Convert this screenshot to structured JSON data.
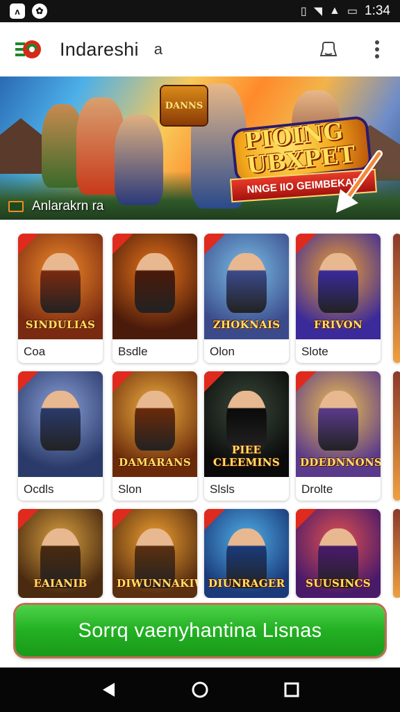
{
  "status_bar": {
    "time": "1:34",
    "left_icons": [
      "notification-app-icon",
      "notification-circle-icon"
    ],
    "right_icons": [
      "vibrate-icon",
      "wifi-icon",
      "signal-icon",
      "battery-icon"
    ]
  },
  "app_bar": {
    "title": "Indareshi",
    "subtitle": "a",
    "actions": [
      "profile-icon",
      "more-vert-icon"
    ]
  },
  "banner": {
    "headline_line1": "PIOING",
    "headline_line2": "UBXPET",
    "ribbon": "NNGE IIO GEIMBEKAD",
    "left_badge": "DANNS",
    "caption": "Anlarakrn ra"
  },
  "games": [
    {
      "label": "Coa",
      "art_title": "SINDULIAS",
      "colors": [
        "#7a2a10",
        "#f08a2a"
      ]
    },
    {
      "label": "Bsdle",
      "art_title": "",
      "colors": [
        "#4a1a0a",
        "#e8741a"
      ]
    },
    {
      "label": "Olon",
      "art_title": "ZHOKNAIS",
      "colors": [
        "#3b4a8a",
        "#7ac0e8"
      ]
    },
    {
      "label": "Slote",
      "art_title": "FRIVON",
      "colors": [
        "#3a2a9a",
        "#f0a030"
      ]
    },
    {
      "label": "Ocdls",
      "art_title": "",
      "colors": [
        "#2a3a6a",
        "#8aa0d8"
      ]
    },
    {
      "label": "Slon",
      "art_title": "DAMARANS",
      "colors": [
        "#6a2a0a",
        "#f0b040"
      ]
    },
    {
      "label": "Slsls",
      "art_title": "PIEE CLEEMINS",
      "colors": [
        "#0a0a0a",
        "#3a4a3a"
      ]
    },
    {
      "label": "Drolte",
      "art_title": "DDEDNNONS",
      "colors": [
        "#5a3a8a",
        "#f0c050"
      ]
    },
    {
      "label": "",
      "art_title": "EAIANIB",
      "colors": [
        "#4a2a10",
        "#d8a040"
      ]
    },
    {
      "label": "",
      "art_title": "DIWUNNAKIWY",
      "colors": [
        "#5a3010",
        "#f0a030"
      ]
    },
    {
      "label": "",
      "art_title": "DIUNRAGER",
      "colors": [
        "#1a3a7a",
        "#50b0e8"
      ]
    },
    {
      "label": "",
      "art_title": "SUUSINCS",
      "colors": [
        "#4a1a6a",
        "#e05050"
      ]
    }
  ],
  "cta": {
    "label": "Sorrq vaenyhantina Lisnas"
  },
  "nav_bar": {
    "buttons": [
      "back-icon",
      "home-icon",
      "recents-icon"
    ]
  }
}
